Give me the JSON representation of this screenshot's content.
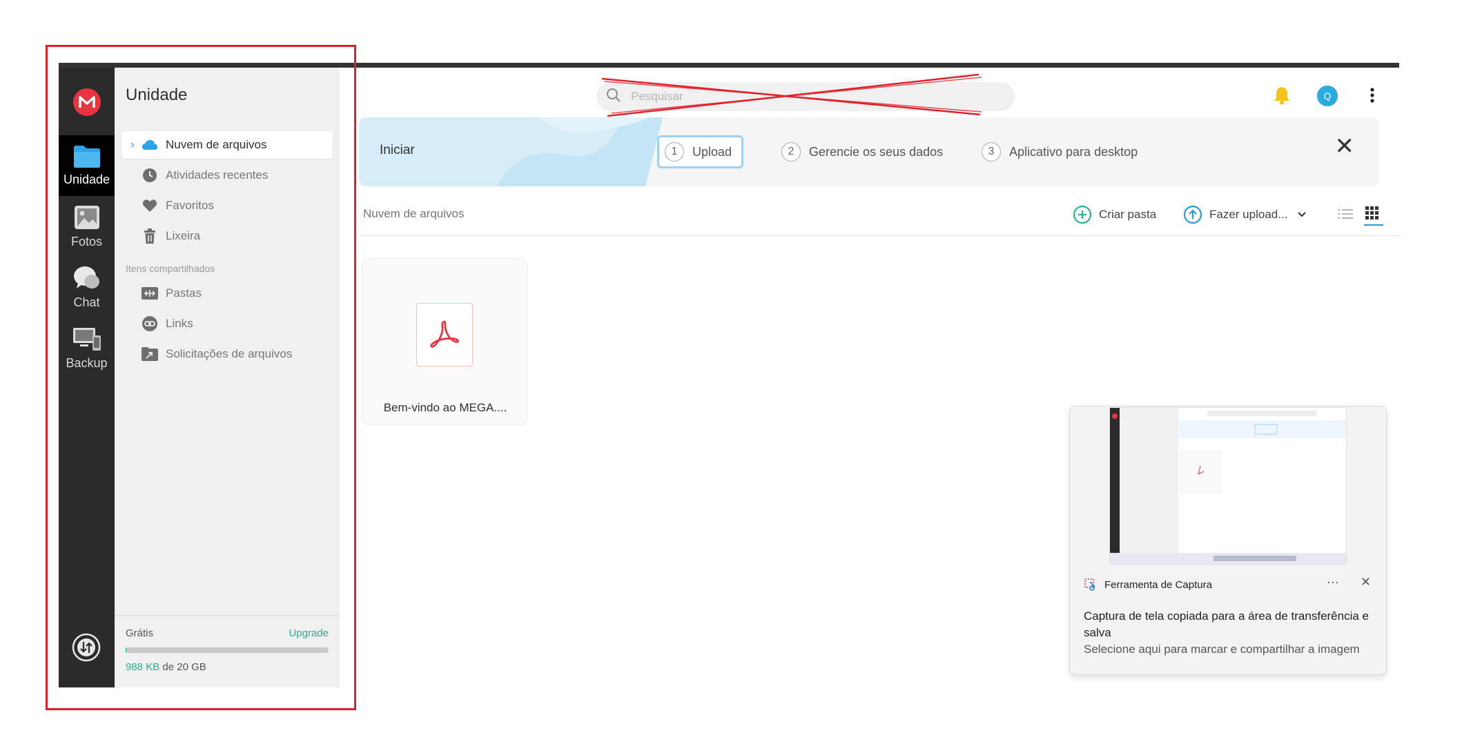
{
  "rail": {
    "items": [
      {
        "label": "Unidade",
        "icon": "folder-icon",
        "active": true
      },
      {
        "label": "Fotos",
        "icon": "photo-icon"
      },
      {
        "label": "Chat",
        "icon": "chat-icon"
      },
      {
        "label": "Backup",
        "icon": "devices-icon"
      }
    ]
  },
  "panel": {
    "title": "Unidade",
    "nav": [
      {
        "label": "Nuvem de arquivos",
        "icon": "cloud-icon",
        "active": true
      },
      {
        "label": "Atividades recentes",
        "icon": "clock-icon"
      },
      {
        "label": "Favoritos",
        "icon": "heart-icon"
      },
      {
        "label": "Lixeira",
        "icon": "trash-icon"
      }
    ],
    "shared_section": "Itens compartilhados",
    "shared": [
      {
        "label": "Pastas",
        "icon": "shared-folder-icon"
      },
      {
        "label": "Links",
        "icon": "link-icon"
      },
      {
        "label": "Solicitações de arquivos",
        "icon": "file-request-icon"
      }
    ],
    "plan": "Grátis",
    "upgrade": "Upgrade",
    "storage_used": "988 KB",
    "storage_total": " de 20 GB",
    "storage_fraction": 5e-05
  },
  "header": {
    "search_placeholder": "Pesquisar",
    "avatar_letter": "Q"
  },
  "banner": {
    "title": "Iniciar",
    "steps": [
      {
        "num": "1",
        "label": "Upload",
        "active": true
      },
      {
        "num": "2",
        "label": "Gerencie os seus dados"
      },
      {
        "num": "3",
        "label": "Aplicativo para desktop"
      }
    ],
    "close": "✕"
  },
  "toolbar": {
    "breadcrumb": "Nuvem de arquivos",
    "create_folder": "Criar pasta",
    "upload": "Fazer upload..."
  },
  "files": [
    {
      "name": "Bem-vindo ao MEGA....",
      "type": "pdf"
    }
  ],
  "toast": {
    "app": "Ferramenta de Captura",
    "dots": "···",
    "close": "✕",
    "message": "Captura de tela copiada para a área de transferência e salva",
    "sub": "Selecione aqui para marcar e compartilhar a imagem"
  },
  "colors": {
    "brand": "#e8343f",
    "accent_green": "#26b28f",
    "accent_blue": "#2a9adf",
    "highlight_red": "#e0202a"
  }
}
